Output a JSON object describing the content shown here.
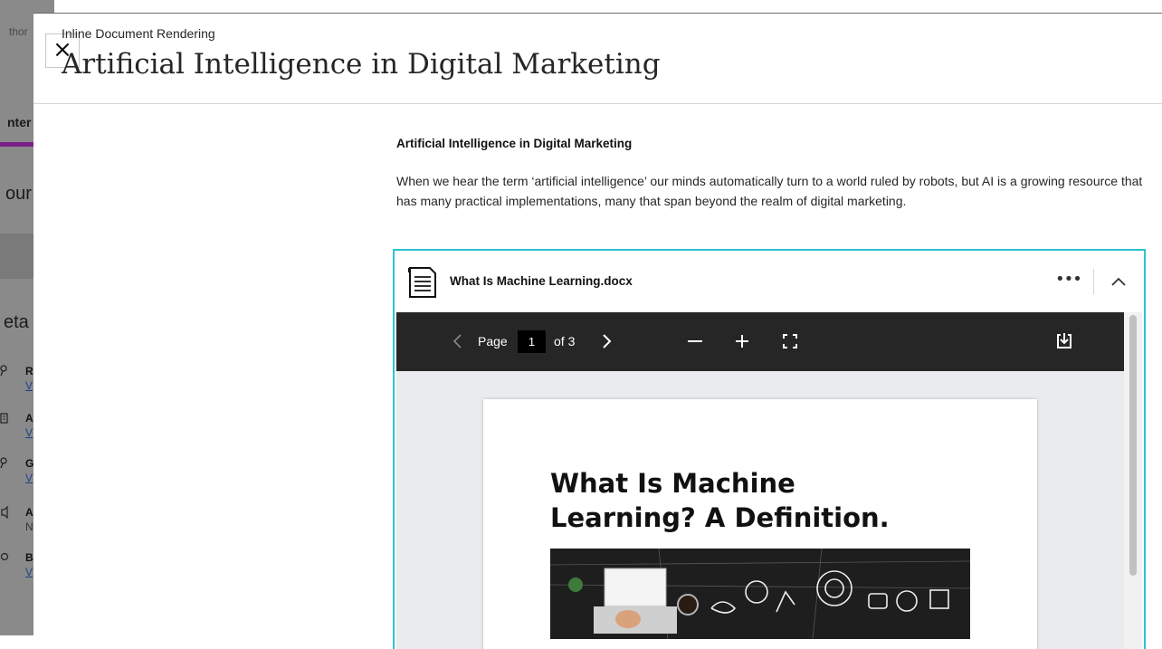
{
  "background": {
    "fragments": [
      "thor",
      "nter",
      "our",
      "eta"
    ],
    "items": [
      {
        "key": "R",
        "value": "V"
      },
      {
        "key": "A",
        "value": "V"
      },
      {
        "key": "G",
        "value": "V"
      },
      {
        "key": "A",
        "value": "N"
      },
      {
        "key": "B",
        "value": "V"
      }
    ],
    "accent_color": "#7a1f86"
  },
  "panel": {
    "close_label": "×",
    "subtitle": "Inline Document Rendering",
    "title": "Artificial Intelligence in Digital Marketing"
  },
  "content": {
    "heading": "Artificial Intelligence in Digital Marketing",
    "body": "When we hear the term ‘artificial intelligence’ our minds automatically turn to a world ruled by robots, but AI is a growing resource that has many practical implementations, many that span beyond the realm of digital marketing."
  },
  "viewer": {
    "border_color": "#2bc4cf",
    "file_name": "What Is Machine Learning.docx",
    "more_label": "•••",
    "toolbar": {
      "page_label": "Page",
      "current_page": "1",
      "of_label": "of 3"
    },
    "document": {
      "title_line1": "What Is Machine",
      "title_line2": "Learning? A Definition."
    }
  },
  "icons": [
    "close-icon",
    "document-icon",
    "more-icon",
    "chevron-up-icon",
    "chevron-left-icon",
    "chevron-right-icon",
    "minus-icon",
    "plus-icon",
    "fullscreen-icon",
    "download-icon"
  ]
}
